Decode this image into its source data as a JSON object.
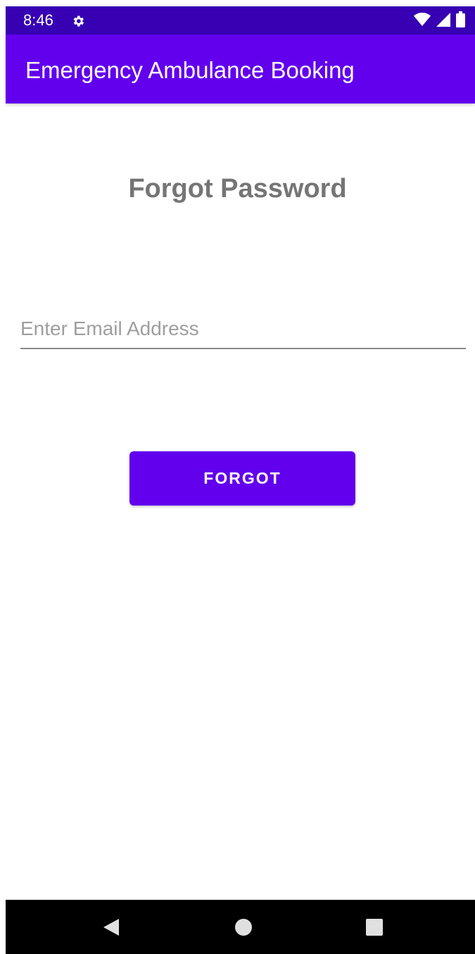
{
  "status_bar": {
    "time": "8:46",
    "icons": [
      "settings-gear-icon",
      "wifi-icon",
      "cellular-signal-icon",
      "battery-icon"
    ],
    "background": "#3700b3"
  },
  "app_bar": {
    "title": "Emergency Ambulance Booking",
    "background": "#6200ee"
  },
  "form": {
    "title": "Forgot Password",
    "email_input": {
      "value": "",
      "placeholder": "Enter Email Address"
    },
    "submit_label": "FORGOT",
    "accent": "#6200ee"
  },
  "nav_bar": {
    "buttons": [
      "back-icon",
      "home-icon",
      "recent-apps-icon"
    ]
  }
}
